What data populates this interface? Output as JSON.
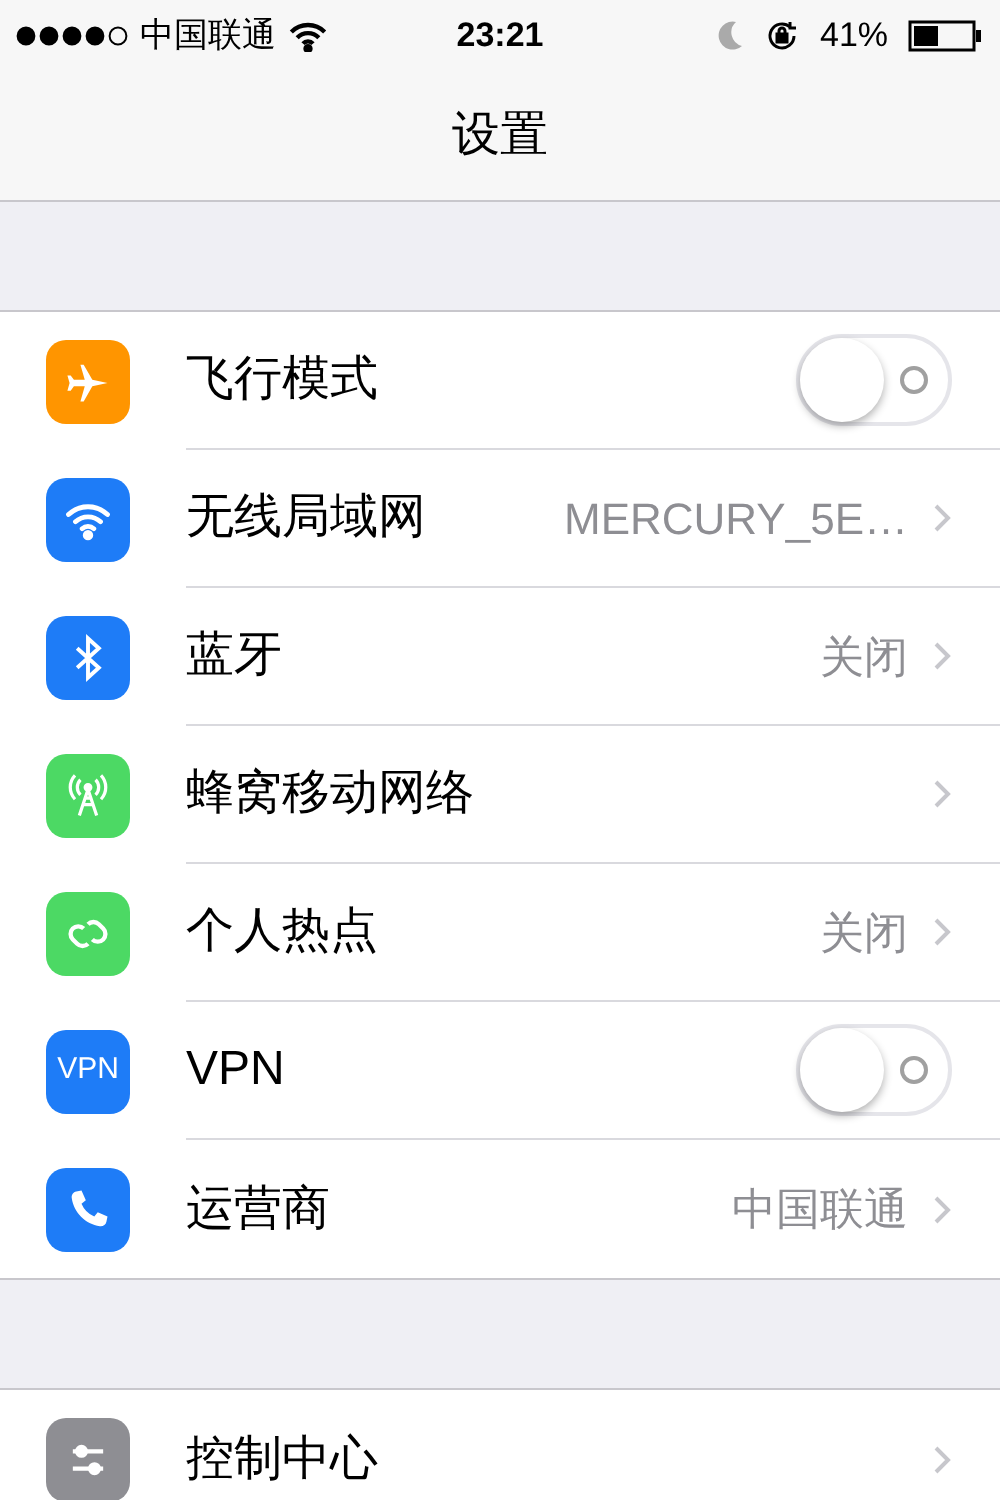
{
  "status_bar": {
    "carrier": "中国联通",
    "time": "23:21",
    "battery": "41%"
  },
  "nav": {
    "title": "设置"
  },
  "groups": [
    {
      "rows": [
        {
          "kind": "toggle",
          "label": "飞行模式",
          "on": false
        },
        {
          "kind": "link",
          "label": "无线局域网",
          "detail": "MERCURY_5E…"
        },
        {
          "kind": "link",
          "label": "蓝牙",
          "detail": "关闭"
        },
        {
          "kind": "link",
          "label": "蜂窝移动网络"
        },
        {
          "kind": "link",
          "label": "个人热点",
          "detail": "关闭"
        },
        {
          "kind": "toggle",
          "label": "VPN",
          "icon_text": "VPN",
          "on": false
        },
        {
          "kind": "link",
          "label": "运营商",
          "detail": "中国联通"
        }
      ]
    },
    {
      "rows": [
        {
          "kind": "link",
          "label": "控制中心"
        }
      ]
    }
  ]
}
